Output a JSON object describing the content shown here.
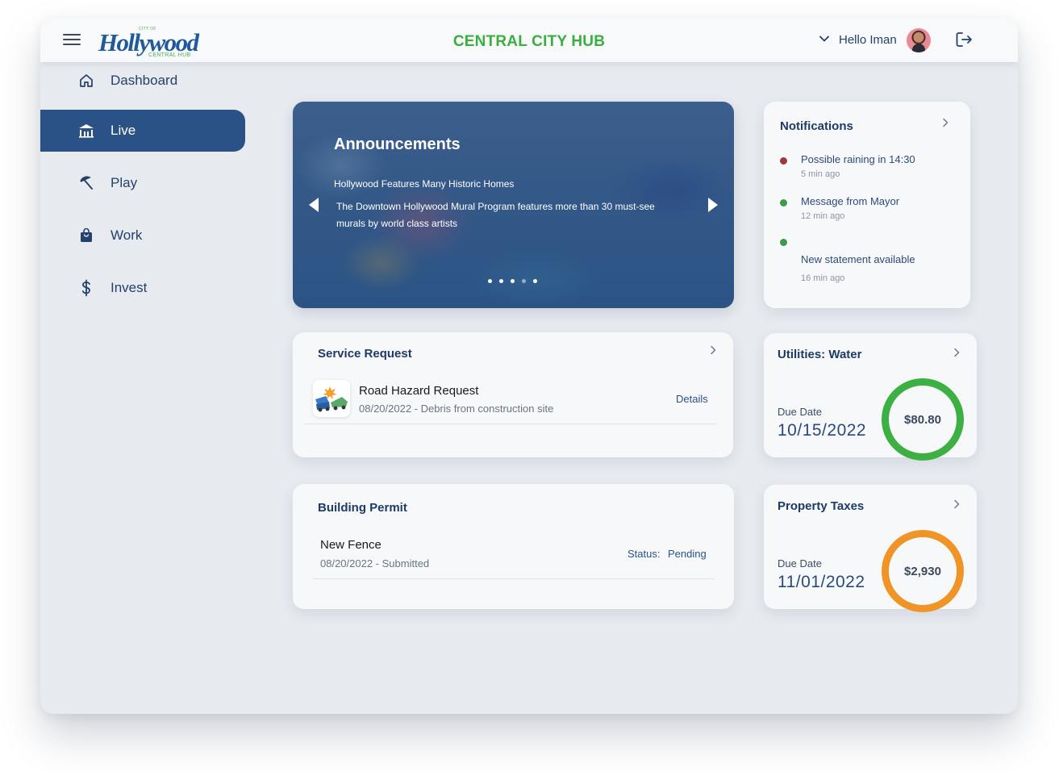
{
  "header": {
    "logo_city_of": "CITY OF",
    "logo_word": "Hollywood",
    "logo_sub": "CENTRAL HUB",
    "app_title": "CENTRAL CITY HUB",
    "greeting": "Hello Iman"
  },
  "sidebar": {
    "items": [
      {
        "label": "Dashboard",
        "icon": "home-icon",
        "active": false
      },
      {
        "label": "Live",
        "icon": "city-icon",
        "active": true
      },
      {
        "label": "Play",
        "icon": "beach-umbrella-icon",
        "active": false
      },
      {
        "label": "Work",
        "icon": "briefcase-icon",
        "active": false
      },
      {
        "label": "Invest",
        "icon": "dollar-icon",
        "active": false
      }
    ]
  },
  "announcements": {
    "title": "Announcements",
    "subtitle": "Hollywood Features Many Historic Homes",
    "text": "The Downtown Hollywood Mural Program features more than 30 must-see murals by world class artists",
    "slide_count": 5
  },
  "notifications": {
    "title": "Notifications",
    "items": [
      {
        "text": "Possible raining in 14:30",
        "time": "5 min ago",
        "color": "#9b3a3a"
      },
      {
        "text": "Message from Mayor",
        "time": "12 min ago",
        "color": "#3c9a4a"
      },
      {
        "text": "New statement available",
        "time": "16 min ago",
        "color": "#3c9a4a"
      }
    ]
  },
  "service_request": {
    "title": "Service Request",
    "item_title": "Road Hazard Request",
    "item_sub": "08/20/2022 - Debris from construction site",
    "link": "Details"
  },
  "building_permit": {
    "title": "Building Permit",
    "item_title": "New Fence",
    "item_sub": "08/20/2022 -  Submitted",
    "status_label": "Status:",
    "status_value": "Pending"
  },
  "utilities": {
    "title": "Utilities: Water",
    "due_label": "Due Date",
    "due_date": "10/15/2022",
    "amount": "$80.80",
    "ring_color": "#3cb043"
  },
  "property_taxes": {
    "title": "Property Taxes",
    "due_label": "Due Date",
    "due_date": "11/01/2022",
    "amount": "$2,930",
    "ring_color": "#f09427"
  },
  "colors": {
    "brand_blue": "#2b5286",
    "brand_green": "#3aae3f",
    "background": "#e7ebf0"
  }
}
